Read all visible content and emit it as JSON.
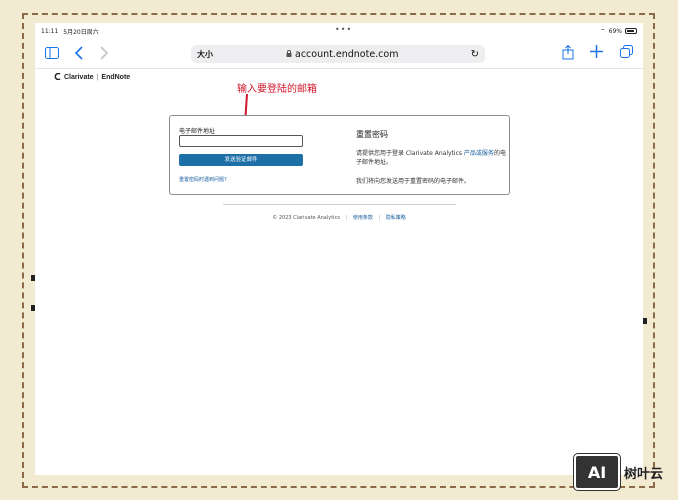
{
  "statusbar": {
    "time": "11:11",
    "date": "5月20日周六",
    "dots": "•••",
    "battery": "69%"
  },
  "toolbar": {
    "text_size": "大小",
    "url": "account.endnote.com"
  },
  "brand": {
    "company": "Clarivate",
    "product": "EndNote"
  },
  "annotation": "输入要登陆的邮箱",
  "form": {
    "email_label": "电子邮件地址",
    "email_value": "",
    "send_button": "发送验证邮件",
    "trouble_link": "重置密码时遇到问题?"
  },
  "reset": {
    "title": "重置密码",
    "desc_prefix": "请提供您用于登录 Clarivate Analytics ",
    "desc_link": "产品或服务",
    "desc_suffix": "的电子邮件地址。",
    "note": "我们将向您发送用于重置密码的电子邮件。"
  },
  "footer": {
    "copyright": "© 2023 Clarivate Analytics",
    "terms": "使用条款",
    "privacy": "隐私策略"
  },
  "watermark": {
    "logo": "AI",
    "text": "树叶云"
  },
  "colors": {
    "accent": "#1a73e8",
    "button": "#1d6fa8",
    "annotation": "#d0162a"
  }
}
